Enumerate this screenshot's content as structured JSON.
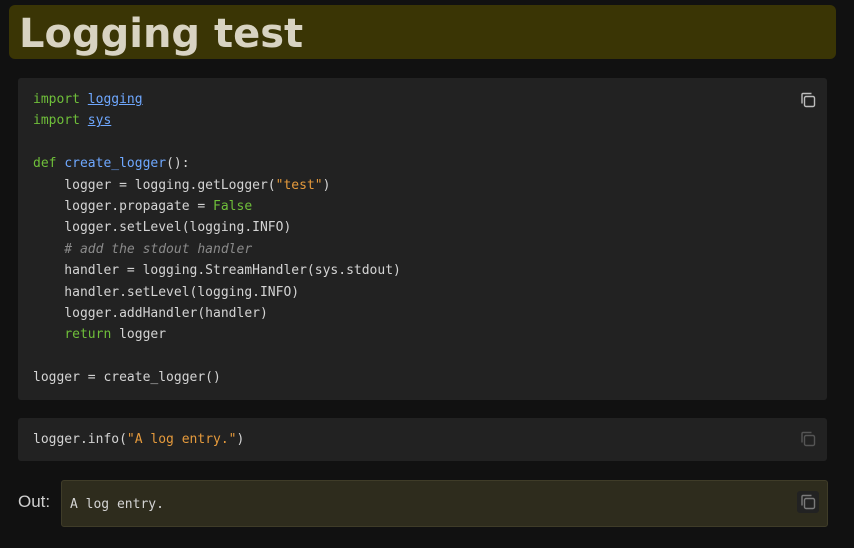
{
  "title": "Logging test",
  "cells": [
    {
      "lines": [
        {
          "t": "import",
          "m": "logging"
        },
        {
          "t": "import",
          "m": "sys"
        },
        {
          "t": ""
        },
        {
          "t": "def",
          "f": "create_logger",
          "rest": "():"
        },
        {
          "code": "    logger = logging.getLogger(",
          "s": "\"test\"",
          "end": ")"
        },
        {
          "code": "    logger.propagate = ",
          "b": "False"
        },
        {
          "code": "    logger.setLevel(logging.INFO)"
        },
        {
          "comment": "    # add the stdout handler"
        },
        {
          "code": "    handler = logging.StreamHandler(sys.stdout)"
        },
        {
          "code": "    handler.setLevel(logging.INFO)"
        },
        {
          "code": "    logger.addHandler(handler)"
        },
        {
          "kw2": "return",
          "code2": " logger"
        },
        {
          "t": ""
        },
        {
          "code": "logger = create_logger()"
        }
      ]
    },
    {
      "line": {
        "code": "logger.info(",
        "s": "\"A log entry.\"",
        "end": ")"
      }
    }
  ],
  "output": {
    "label": "Out:",
    "text": "A log entry."
  },
  "icons": {
    "copy": "copy-icon"
  },
  "colors": {
    "title_bg": "#3a3505",
    "cell_bg": "#222222",
    "keyword": "#6fbf3a",
    "module": "#6fa8ff",
    "string": "#e59a3c",
    "comment": "#8a8a8a",
    "output_bg": "#2e2c1d"
  }
}
